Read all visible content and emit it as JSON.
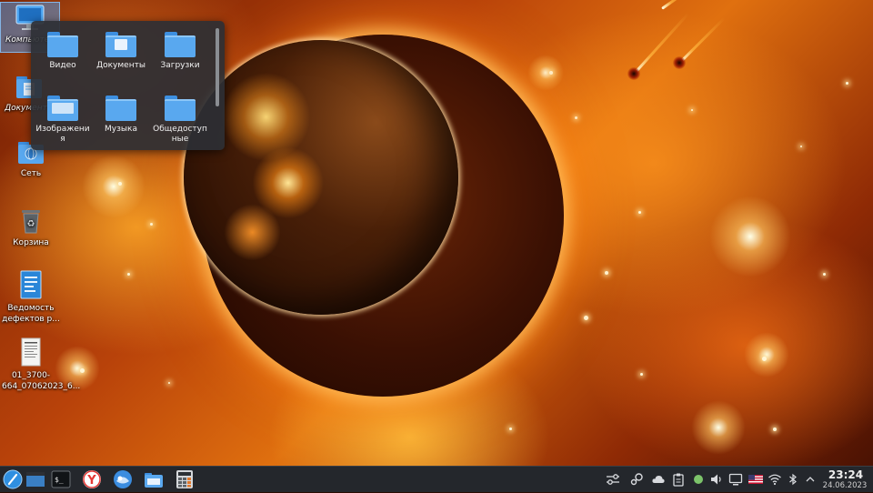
{
  "desktop": {
    "icons": [
      {
        "label": "Компьютер"
      },
      {
        "label": "Документы"
      },
      {
        "label": "Сеть"
      },
      {
        "label": "Корзина"
      },
      {
        "label": "Ведомость дефектов р..."
      },
      {
        "label": "01_3700-664_07062023_6..."
      }
    ]
  },
  "folder_popup": {
    "items": [
      {
        "label": "Видео"
      },
      {
        "label": "Документы"
      },
      {
        "label": "Загрузки"
      },
      {
        "label": "Изображения"
      },
      {
        "label": "Музыка"
      },
      {
        "label": "Общедоступные"
      }
    ]
  },
  "taskbar": {
    "apps": [
      {
        "icon": "start-menu-icon"
      },
      {
        "icon": "show-desktop-icon"
      },
      {
        "icon": "terminal-icon",
        "text": "$_"
      },
      {
        "icon": "yandex-browser-icon",
        "text": "Y"
      },
      {
        "icon": "mail-client-icon"
      },
      {
        "icon": "file-manager-icon"
      },
      {
        "icon": "calculator-icon"
      }
    ],
    "tray": [
      {
        "icon": "settings-sliders-icon"
      },
      {
        "icon": "steam-icon"
      },
      {
        "icon": "cloud-sync-icon"
      },
      {
        "icon": "clipboard-icon"
      },
      {
        "icon": "status-dot-icon"
      },
      {
        "icon": "volume-icon"
      },
      {
        "icon": "display-icon"
      },
      {
        "icon": "keyboard-layout-us-flag-icon"
      },
      {
        "icon": "wifi-icon"
      },
      {
        "icon": "bluetooth-icon"
      },
      {
        "icon": "tray-expand-chevron-icon"
      }
    ],
    "clock": {
      "time": "23:24",
      "date": "24.06.2023"
    }
  },
  "colors": {
    "taskbar_bg": "#24272c",
    "popup_bg": "#2d2f34",
    "folder_blue": "#59a8ef",
    "selection": "#5096dc"
  }
}
